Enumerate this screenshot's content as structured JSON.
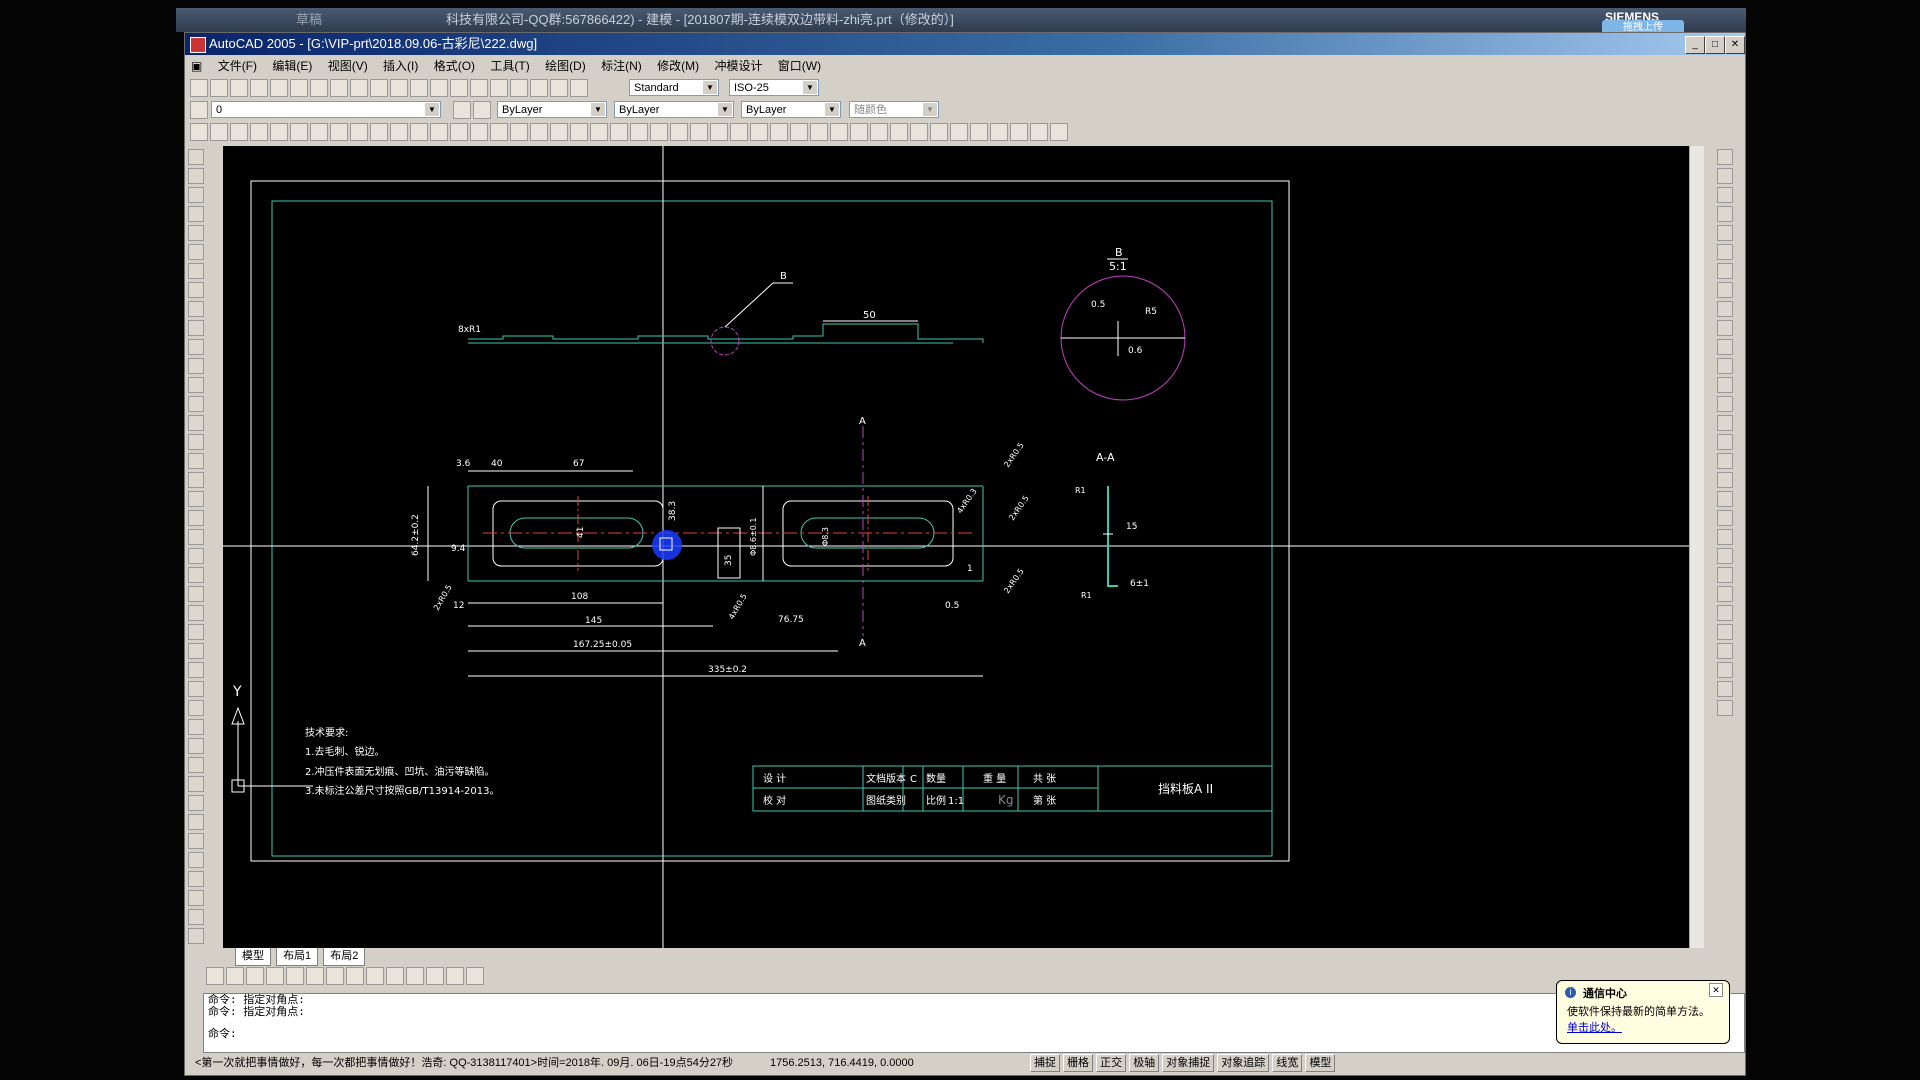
{
  "background_window": {
    "tabs": [
      "草稿"
    ],
    "title": "科技有限公司-QQ群:567866422) - 建模 - [201807期-连续模双边带料-zhi亮.prt（修改的）]",
    "brand": "SIEMENS",
    "badge": "拖拽上传"
  },
  "app": {
    "title": "AutoCAD 2005 - [G:\\VIP-prt\\2018.09.06-古彩尼\\222.dwg]",
    "menu": [
      "文件(F)",
      "编辑(E)",
      "视图(V)",
      "插入(I)",
      "格式(O)",
      "工具(T)",
      "绘图(D)",
      "标注(N)",
      "修改(M)",
      "冲模设计",
      "窗口(W)"
    ],
    "text_style": "Standard",
    "dim_style": "ISO-25",
    "layer": "0",
    "color": "ByLayer",
    "linetype": "ByLayer",
    "lineweight": "ByLayer",
    "plotstyle": "随颜色"
  },
  "drawing": {
    "detail_label": "B",
    "detail_scale": "5:1",
    "detail_dims": [
      "0.5",
      "R5",
      "0.6"
    ],
    "callout_b": "B",
    "dim_50": "50",
    "label_8xr1": "8xR1",
    "section_a_top": "A",
    "section_a_bottom": "A",
    "section_title": "A-A",
    "plan_dims": {
      "d36": "3.6",
      "d40": "40",
      "d67": "67",
      "d64": "64.2±0.2",
      "d94": "9.4",
      "d41": "41",
      "d383": "38.3",
      "d108": "108",
      "d145": "145",
      "d1672": "167.25±0.05",
      "d335": "335±0.2",
      "d35": "35",
      "d12": "12",
      "d4xr05": "4xR0.5",
      "d7675": "76.75",
      "d058": "Φ8.6±0.1",
      "d488": "Φ8.3",
      "d05": "0.5",
      "d1": "1",
      "d2xr05a": "2xR0.5",
      "d2xr05b": "2xR0.5",
      "d2xr05c": "2xR0.5",
      "d2xr05d": "2xR0.5",
      "d4xr03": "4xR0.3",
      "d15": "15",
      "d6": "6±1",
      "r1": "R1",
      "r2": "R1"
    },
    "notes_title": "技术要求:",
    "notes": [
      "1.去毛刺、锐边。",
      "2.冲压件表面无划痕、凹坑、油污等缺陷。",
      "3.未标注公差尺寸按照GB/T13914-2013。"
    ],
    "title_block": {
      "design": "设 计",
      "check": "校 对",
      "doc_ver": "文档版本",
      "ver": "C",
      "qty": "数量",
      "weight": "重 量",
      "total": "共 张",
      "drawing_type": "图纸类别",
      "scale_label": "比例",
      "scale": "1:1",
      "kg": "Kg",
      "sheet": "第 张",
      "part_name": "挡料板A II"
    },
    "ucs_y": "Y"
  },
  "layout_tabs": [
    "模型",
    "布局1",
    "布局2"
  ],
  "command_lines": [
    "命令: 指定对角点:",
    "命令: 指定对角点:",
    "命令:"
  ],
  "status": {
    "marquee": "<第一次就把事情做好，每一次都把事情做好！浩奇: QQ-3138117401>时间=2018年. 09月. 06日-19点54分27秒",
    "coords": "1756.2513,  716.4419,  0.0000",
    "toggles": [
      "捕捉",
      "栅格",
      "正交",
      "极轴",
      "对象捕捉",
      "对象追踪",
      "线宽",
      "模型"
    ]
  },
  "notification": {
    "title": "通信中心",
    "body": "使软件保持最新的简单方法。",
    "link": "单击此处。"
  }
}
